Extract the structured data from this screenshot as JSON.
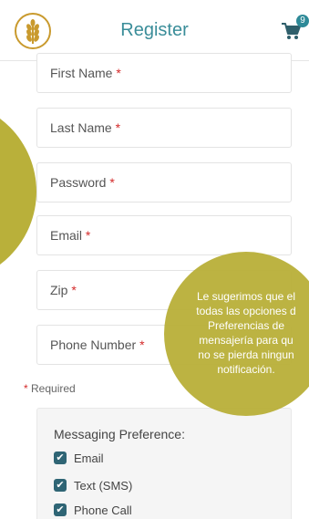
{
  "header": {
    "title": "Register",
    "cart_count": "9",
    "accent_color": "#3a8d99"
  },
  "form": {
    "fields": [
      {
        "label": "First Name",
        "required": "*"
      },
      {
        "label": "Last Name",
        "required": "*"
      },
      {
        "label": "Password",
        "required": "*"
      },
      {
        "label": "Email",
        "required": "*"
      },
      {
        "label": "Zip",
        "required": "*"
      },
      {
        "label": "Phone Number",
        "required": "*"
      }
    ],
    "required_note": "Required",
    "required_mark": "*"
  },
  "preferences": {
    "title": "Messaging Preference:",
    "options": [
      {
        "label": "Email",
        "checked": true
      },
      {
        "label": "Text (SMS)",
        "checked": true
      },
      {
        "label": "Phone Call",
        "checked": true
      }
    ]
  },
  "tooltip": {
    "text": "Le sugerimos que el\ntodas las opciones d\nPreferencias de\nmensajería para qu\nno se pierda ningun\nnotificación.",
    "color": "#b9b03a"
  },
  "icons": {
    "logo": "wheat-logo-icon",
    "cart": "shopping-cart-icon",
    "check": "checkbox-checked-icon"
  }
}
